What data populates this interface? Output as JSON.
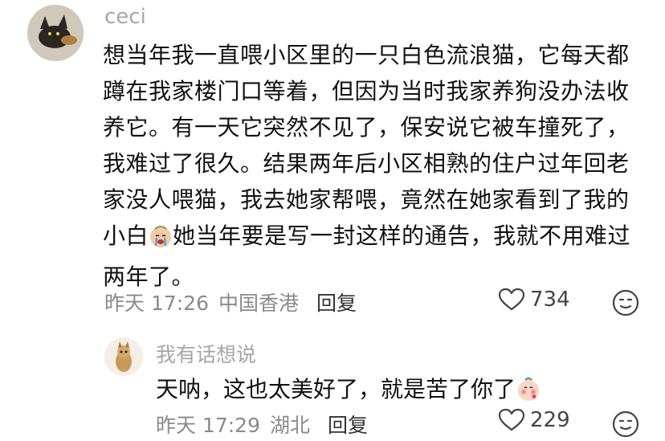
{
  "comment": {
    "username": "ceci",
    "text_before_emoji": "想当年我一直喂小区里的一只白色流浪猫，它每天都蹲在我家楼门口等着，但因为当时我家养狗没办法收养它。有一天它突然不见了，保安说它被车撞死了，我难过了很久。结果两年后小区相熟的住户过年回老家没人喂猫，我去她家帮喂，竟然在她家看到了我的小白",
    "inline_emoji": "crying-face-sticker",
    "text_after_emoji": "她当年要是写一封这样的通告，我就不用难过两年了。",
    "date": "昨天 17:26",
    "location": "中国香港",
    "reply_label": "回复",
    "like_count": "734"
  },
  "reply": {
    "username": "我有话想说",
    "text": "天呐，这也太美好了，就是苦了你了",
    "inline_emoji": "blushing-peach-sticker",
    "date": "昨天 17:29",
    "location": "湖北",
    "reply_label": "回复",
    "like_count": "229"
  },
  "icons": {
    "like": "heart-outline-icon",
    "emoji": "smiley-face-icon"
  },
  "colors": {
    "username": "#a6a6a6",
    "meta": "#8a8a8a",
    "text": "#111111",
    "icon": "#444444"
  }
}
